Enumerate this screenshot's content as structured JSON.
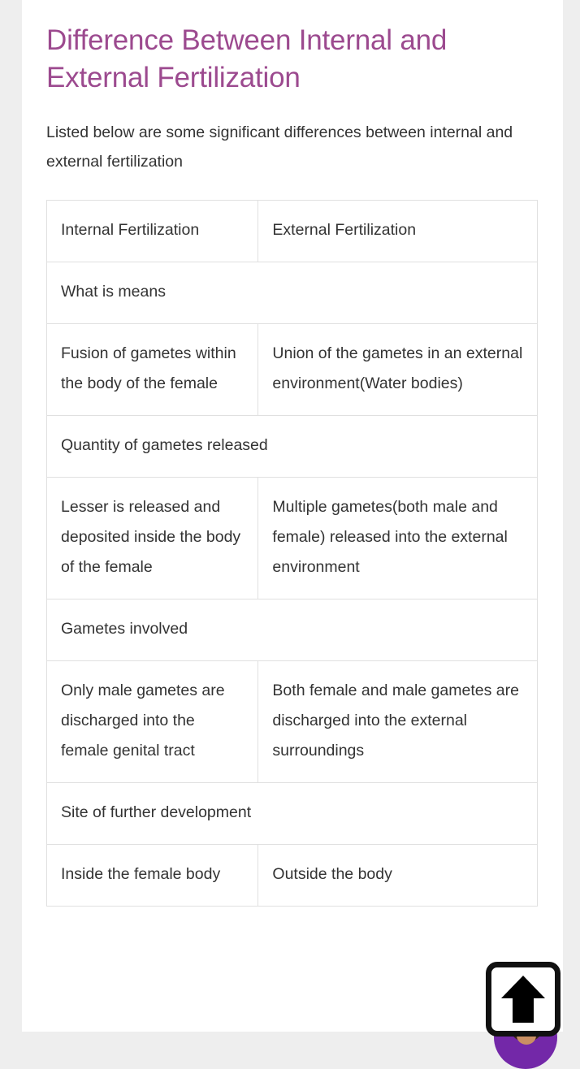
{
  "page": {
    "title": "Difference Between Internal and External Fertilization",
    "intro": "Listed below are some significant differences between internal and external fertilization",
    "accent_color": "#9c4a8f",
    "text_color": "#333333",
    "background_color": "#eeeeee",
    "page_background": "#ffffff"
  },
  "table": {
    "headers": {
      "left": "Internal Fertilization",
      "right": "External Fertilization"
    },
    "sections": [
      {
        "heading": "What is means",
        "left": "Fusion of gametes within the body of the female",
        "right": "Union of the gametes in an external environment(Water bodies)"
      },
      {
        "heading": "Quantity of gametes released",
        "left": "Lesser is released and deposited inside the body of the female",
        "right": "Multiple gametes(both male and female) released into the external environment"
      },
      {
        "heading": "Gametes involved",
        "left": "Only male gametes are discharged into the female genital tract",
        "right": "Both female and male gametes are discharged into the external surroundings"
      },
      {
        "heading": "Site of further development",
        "left": "Inside the female body",
        "right": "Outside the body"
      }
    ]
  },
  "widgets": {
    "scroll_to_top_icon": "arrow-up-icon",
    "avatar_icon": "person-avatar-icon",
    "avatar_color": "#7328a8",
    "scroll_button_color": "#111111"
  }
}
